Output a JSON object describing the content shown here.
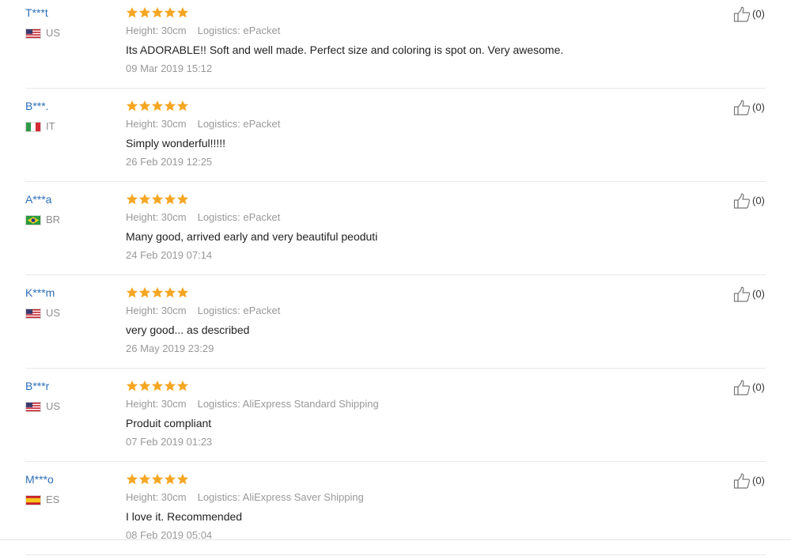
{
  "colors": {
    "star": "#f5a623",
    "username": "#2d6eb8",
    "meta": "#999999",
    "text": "#222222"
  },
  "icons": {
    "rating": "star-icon",
    "helpful": "thumbs-up-icon"
  },
  "reviews": [
    {
      "user": "T***t",
      "country": "US",
      "flag": "flag-us",
      "rating": 5,
      "height": "Height: 30cm",
      "logistics": "Logistics: ePacket",
      "text": "Its ADORABLE!! Soft and well made. Perfect size and coloring is spot on. Very awesome.",
      "date": "09 Mar 2019 15:12",
      "helpful": "(0)"
    },
    {
      "user": "B***.",
      "country": "IT",
      "flag": "flag-it",
      "rating": 5,
      "height": "Height: 30cm",
      "logistics": "Logistics: ePacket",
      "text": "Simply wonderful!!!!!",
      "date": "26 Feb 2019 12:25",
      "helpful": "(0)"
    },
    {
      "user": "A***a",
      "country": "BR",
      "flag": "flag-br",
      "rating": 5,
      "height": "Height: 30cm",
      "logistics": "Logistics: ePacket",
      "text": "Many good, arrived early and very beautiful peoduti",
      "date": "24 Feb 2019 07:14",
      "helpful": "(0)"
    },
    {
      "user": "K***m",
      "country": "US",
      "flag": "flag-us",
      "rating": 5,
      "height": "Height: 30cm",
      "logistics": "Logistics: ePacket",
      "text": "very good... as described",
      "date": "26 May 2019 23:29",
      "helpful": "(0)"
    },
    {
      "user": "B***r",
      "country": "US",
      "flag": "flag-us",
      "rating": 5,
      "height": "Height: 30cm",
      "logistics": "Logistics: AliExpress Standard Shipping",
      "text": "Produit compliant",
      "date": "07 Feb 2019 01:23",
      "helpful": "(0)"
    },
    {
      "user": "M***o",
      "country": "ES",
      "flag": "flag-es",
      "rating": 5,
      "height": "Height: 30cm",
      "logistics": "Logistics: AliExpress Saver Shipping",
      "text": "I love it. Recommended",
      "date": "08 Feb 2019 05:04",
      "helpful": "(0)"
    }
  ]
}
